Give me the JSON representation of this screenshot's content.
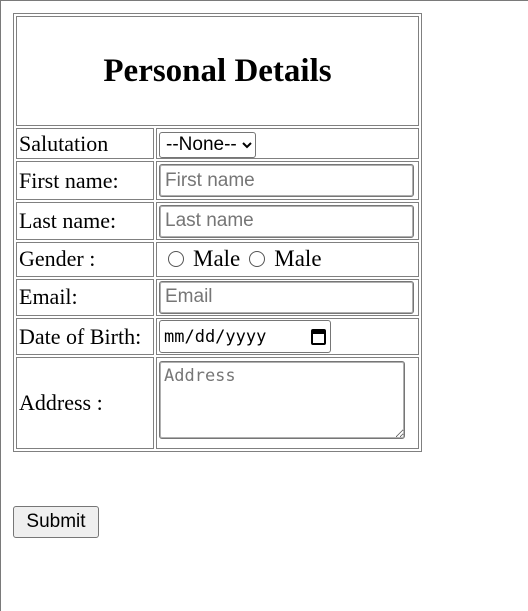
{
  "form": {
    "title": "Personal Details",
    "salutation": {
      "label": "Salutation",
      "selected": "--None--"
    },
    "first_name": {
      "label": "First name:",
      "placeholder": "First name",
      "value": ""
    },
    "last_name": {
      "label": "Last name:",
      "placeholder": "Last name",
      "value": ""
    },
    "gender": {
      "label": "Gender :",
      "options": [
        "Male",
        "Male"
      ]
    },
    "email": {
      "label": "Email:",
      "placeholder": "Email",
      "value": ""
    },
    "dob": {
      "label": "Date of Birth:",
      "placeholder": "mm/dd/yyyy",
      "icon": "calendar-icon"
    },
    "address": {
      "label": "Address :",
      "placeholder": "Address"
    },
    "submit_label": "Submit"
  }
}
